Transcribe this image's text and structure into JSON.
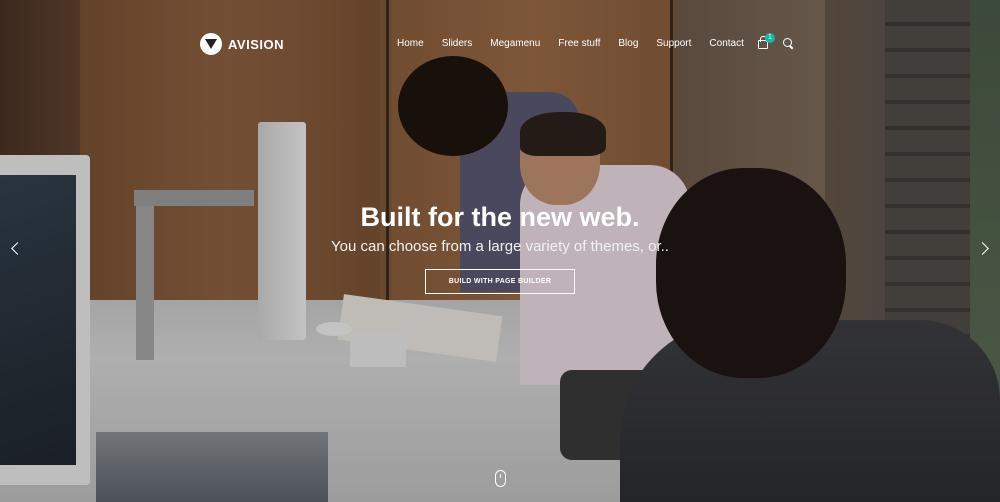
{
  "brand": {
    "name": "AVISION",
    "logo_icon": "avision-logo-icon"
  },
  "nav": {
    "items": [
      {
        "label": "Home"
      },
      {
        "label": "Sliders"
      },
      {
        "label": "Megamenu"
      },
      {
        "label": "Free stuff"
      },
      {
        "label": "Blog"
      },
      {
        "label": "Support"
      },
      {
        "label": "Contact"
      }
    ]
  },
  "cart": {
    "count": "1",
    "icon": "shopping-bag-icon"
  },
  "search": {
    "icon": "search-icon"
  },
  "slide": {
    "title": "Built for the new web.",
    "subtitle": "You can choose from a large variety of themes, or..",
    "cta_label": "BUILD WITH PAGE BUILDER"
  },
  "slider_controls": {
    "prev_icon": "chevron-left-icon",
    "next_icon": "chevron-right-icon",
    "scroll_icon": "scroll-mouse-icon"
  },
  "colors": {
    "accent": "#19b6a1",
    "text": "#ffffff"
  }
}
